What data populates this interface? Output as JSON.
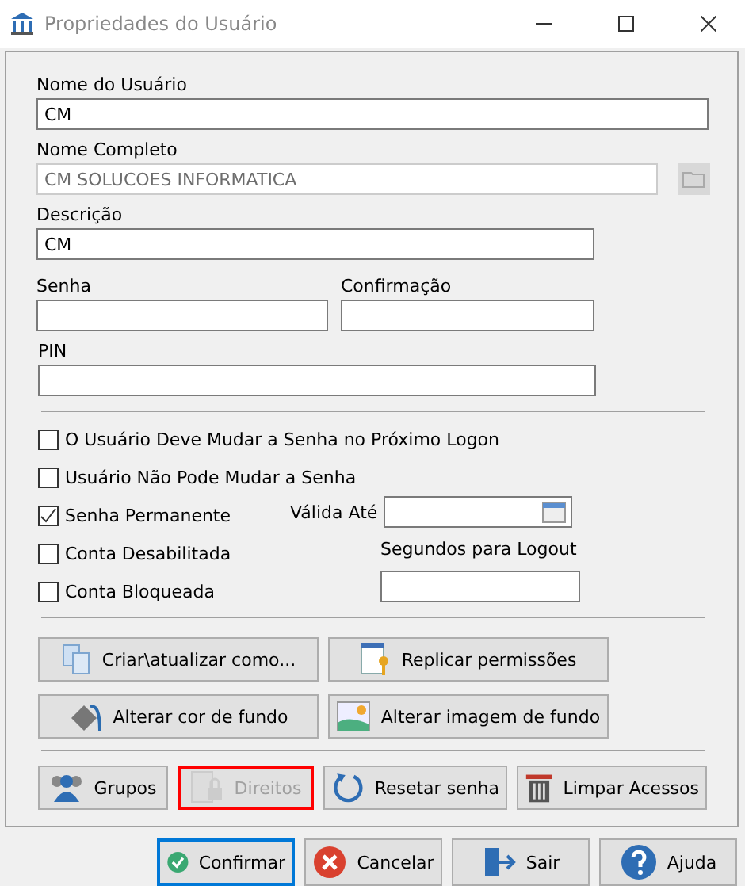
{
  "window": {
    "title": "Propriedades do Usuário"
  },
  "fields": {
    "username": {
      "label": "Nome do Usuário",
      "value": "CM"
    },
    "full_name": {
      "label": "Nome Completo",
      "value": "CM SOLUCOES INFORMATICA",
      "disabled": true
    },
    "description": {
      "label": "Descrição",
      "value": "CM"
    },
    "password": {
      "label": "Senha"
    },
    "confirmation": {
      "label": "Confirmação"
    },
    "pin": {
      "label": "PIN"
    }
  },
  "options": [
    {
      "label": "O Usuário Deve Mudar a Senha no Próximo Logon",
      "checked": false
    },
    {
      "label": "Usuário Não Pode Mudar a Senha",
      "checked": false
    },
    {
      "label": "Senha Permanente",
      "checked": true
    },
    {
      "label": "Conta Desabilitada",
      "checked": false
    },
    {
      "label": "Conta Bloqueada",
      "checked": false
    }
  ],
  "valid_until": {
    "label": "Válida Até"
  },
  "logout_seconds": {
    "label": "Segundos para Logout"
  },
  "actions": [
    {
      "label": "Criar\\atualizar como..."
    },
    {
      "label": "Replicar permissões"
    },
    {
      "label": "Alterar cor de fundo"
    },
    {
      "label": "Alterar imagem de fundo"
    }
  ],
  "tools": [
    {
      "label": "Grupos",
      "disabled": false,
      "highlighted": false
    },
    {
      "label": "Direitos",
      "disabled": true,
      "highlighted": true
    },
    {
      "label": "Resetar senha",
      "disabled": false,
      "highlighted": false
    },
    {
      "label": "Limpar Acessos",
      "disabled": false,
      "highlighted": false
    }
  ],
  "footer": [
    {
      "label": "Confirmar",
      "selected": true
    },
    {
      "label": "Cancelar",
      "selected": false
    },
    {
      "label": "Sair",
      "selected": false
    },
    {
      "label": "Ajuda",
      "selected": false
    }
  ]
}
